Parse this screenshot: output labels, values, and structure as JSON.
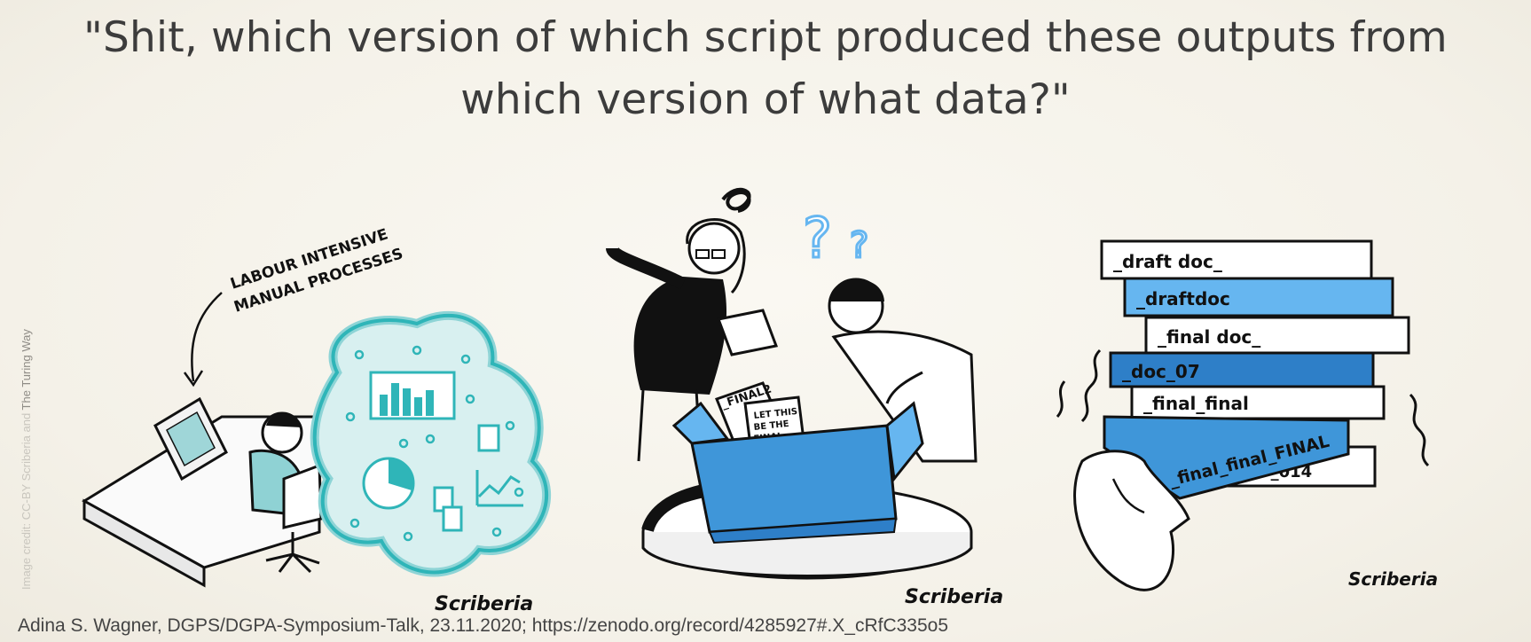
{
  "slide": {
    "quote": "\"Shit, which version of which script produced these outputs from which version of what data?\"",
    "side_credit_prefix": "Image credit: CC-BY Scriberia and ",
    "side_credit_name": "The Turing Way",
    "footer": "Adina S. Wagner, DGPS/DGPA-Symposium-Talk, 23.11.2020; https://zenodo.org/record/4285927#.X_cRfC335o5"
  },
  "illustration": {
    "annotation_line1": "LABOUR INTENSIVE",
    "annotation_line2": "MANUAL PROCESSES",
    "box_note1": "_FINAL2",
    "box_note2_line1": "LET THIS",
    "box_note2_line2": "BE THE",
    "box_note2_line3": "FINAL...",
    "files": [
      "_draft doc_",
      "_draftdoc",
      "_final doc_",
      "_doc_07",
      "_final_final",
      "_final_final_FINAL",
      "777_014"
    ],
    "signature": "Scriberia",
    "colors": {
      "teal": "#2fb5b8",
      "blue": "#3f96d9",
      "light_blue": "#66b6f0",
      "dark_blue": "#2e7fc8"
    }
  }
}
